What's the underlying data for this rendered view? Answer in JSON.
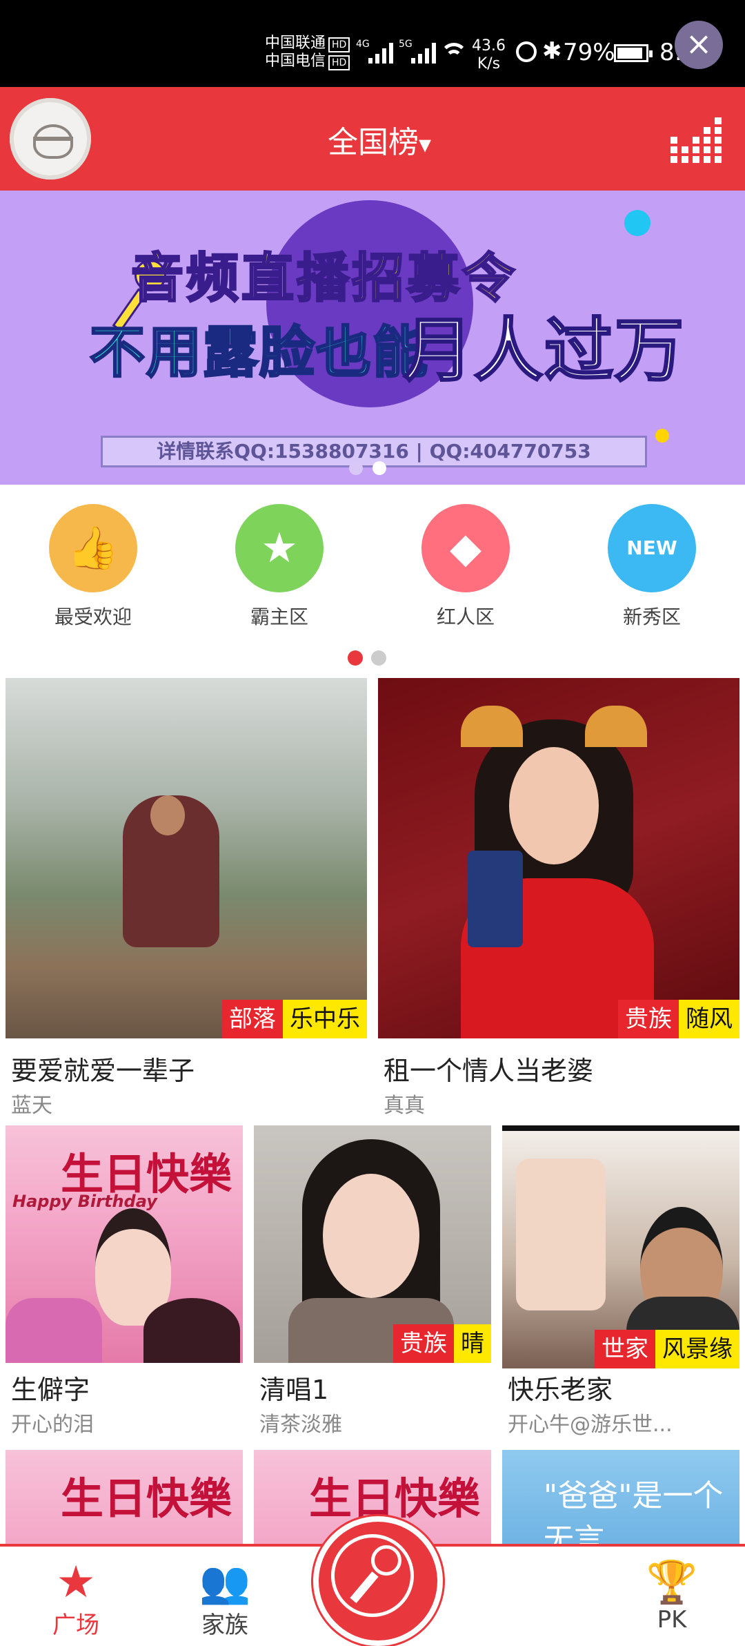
{
  "status_bar": {
    "carrier1": "中国联通",
    "carrier2": "中国电信",
    "hd": "HD",
    "net1": "4G",
    "net2": "5G",
    "speed_value": "43.6",
    "speed_unit": "K/s",
    "battery": "79%",
    "time": "8:51"
  },
  "header": {
    "title": "全国榜",
    "title_caret": "▾"
  },
  "banner": {
    "line1": "音频直播招募令",
    "line2a": "不用露脸也能",
    "line2b": "月人过万",
    "contact": "详情联系QQ:1538807316 | QQ:404770753",
    "close_glyph": "×",
    "active_page": 2,
    "page_count": 2
  },
  "categories": [
    {
      "label": "最受欢迎",
      "icon": "thumbs-up-icon",
      "color": "#f7b84b",
      "glyph": "👍"
    },
    {
      "label": "霸主区",
      "icon": "medal-icon",
      "color": "#7ed35a",
      "glyph": "★"
    },
    {
      "label": "红人区",
      "icon": "diamond-icon",
      "color": "#ff6f7d",
      "glyph": "◆"
    },
    {
      "label": "新秀区",
      "icon": "new-tag-icon",
      "color": "#3cb8f2",
      "glyph": "NEW"
    }
  ],
  "category_pages": {
    "active": 1,
    "count": 2
  },
  "featured": [
    {
      "title": "要爱就爱一辈子",
      "user": "蓝天",
      "tag1": "部落",
      "tag2": "乐中乐"
    },
    {
      "title": "租一个情人当老婆",
      "user": "真真",
      "tag1": "贵族",
      "tag2": "随风"
    }
  ],
  "grid": [
    {
      "title": "生僻字",
      "user": "开心的泪",
      "tag1": "",
      "tag2": ""
    },
    {
      "title": "清唱1",
      "user": "清茶淡雅",
      "tag1": "贵族",
      "tag2": "晴"
    },
    {
      "title": "快乐老家",
      "user": "开心牛@游乐世...",
      "tag1": "世家",
      "tag2": "风景缘"
    }
  ],
  "bottom_nav": {
    "plaza": "广场",
    "family": "家族",
    "pk": "PK"
  },
  "colors": {
    "primary_red": "#e8383d",
    "tag_red": "#e8262d",
    "tag_yellow": "#ffe800"
  }
}
